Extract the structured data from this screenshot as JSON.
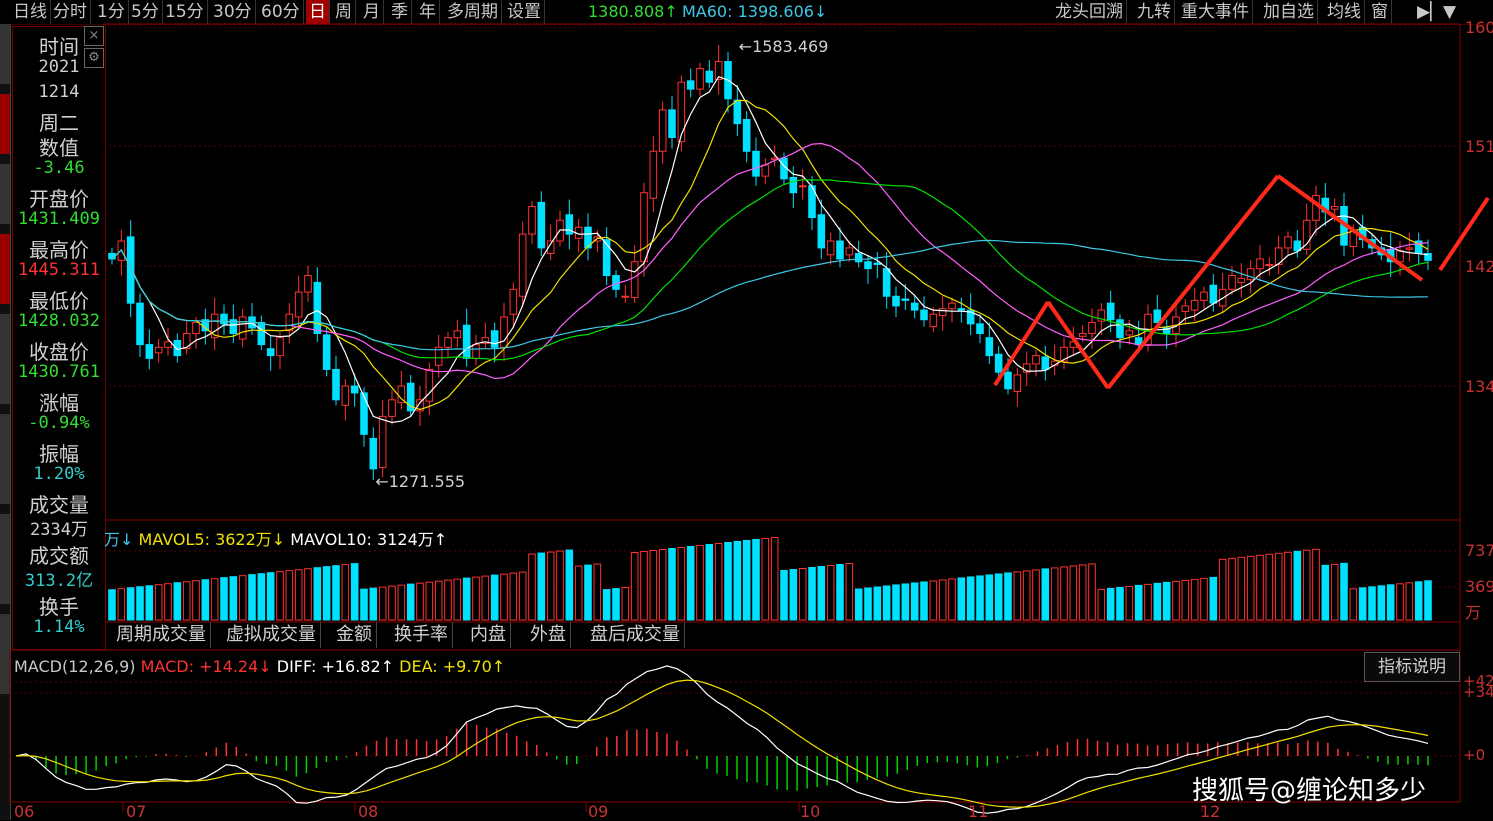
{
  "toolbar": {
    "items": [
      "日线",
      "分时",
      "1分",
      "5分",
      "15分",
      "30分",
      "60分",
      "日",
      "周",
      "月",
      "季",
      "年",
      "多周期",
      "设置"
    ],
    "ma30_value": "1380.808↑",
    "ma60_value": "MA60: 1398.606↓",
    "right_items": [
      "龙头回溯",
      "九转",
      "重大事件",
      "加自选",
      "均线",
      "窗"
    ]
  },
  "info_panel": {
    "rows": [
      {
        "label": "时间",
        "value": "2021",
        "value2": "1214",
        "value3": "周二",
        "color": "#d0d0d0"
      },
      {
        "label": "数值",
        "value": "-3.46",
        "color": "#33dd33"
      },
      {
        "label": "开盘价",
        "value": "1431.409",
        "color": "#33dd33"
      },
      {
        "label": "最高价",
        "value": "1445.311",
        "color": "#ff3333"
      },
      {
        "label": "最低价",
        "value": "1428.032",
        "color": "#33dd33"
      },
      {
        "label": "收盘价",
        "value": "1430.761",
        "color": "#33dd33"
      },
      {
        "label": "涨幅",
        "value": "-0.94%",
        "color": "#33dd33"
      },
      {
        "label": "振幅",
        "value": "1.20%",
        "color": "#33cccc"
      },
      {
        "label": "成交量",
        "value": "2334万",
        "color": "#d0d0d0"
      },
      {
        "label": "成交额",
        "value": "313.2亿",
        "color": "#33cccc"
      },
      {
        "label": "换手",
        "value": "1.14%",
        "color": "#33cccc"
      }
    ],
    "close_icon": "×",
    "gear_icon": "⚙"
  },
  "volume_legend": {
    "prefix": "万↓",
    "mavol5": "MAVOL5: 3622万↓",
    "mavol10": "MAVOL10: 3124万↑"
  },
  "volume_tabs": [
    "周期成交量",
    "虚拟成交量",
    "金额",
    "换手率",
    "内盘",
    "外盘",
    "盘后成交量"
  ],
  "macd_legend": {
    "name": "MACD(12,26,9)",
    "macd": "MACD: +14.24↓",
    "diff": "DIFF: +16.82↑",
    "dea": "DEA: +9.70↑"
  },
  "help_button": "指标说明",
  "watermark": "搜狐号@缠论知多少",
  "colors": {
    "up": "#ff3232",
    "down": "#00e0ff",
    "ma5": "#ffffff",
    "ma10": "#f0e000",
    "ma20": "#ff60ff",
    "ma30": "#00e000",
    "ma60": "#3cc8e6",
    "arrow": "#ff2a1a"
  },
  "chart_data": {
    "type": "candlestick",
    "months": [
      "06",
      "07",
      "08",
      "09",
      "10",
      "11",
      "12"
    ],
    "price_axis": [
      "160",
      "151",
      "142",
      "134"
    ],
    "volume_axis": [
      "737",
      "369",
      "万"
    ],
    "macd_axis": [
      "+42",
      "+34",
      "+0"
    ],
    "price_range": [
      1250,
      1610
    ],
    "max_label": "1583.469",
    "min_label": "1271.555",
    "closes": [
      1432,
      1445,
      1400,
      1370,
      1360,
      1368,
      1372,
      1362,
      1378,
      1386,
      1380,
      1392,
      1385,
      1378,
      1390,
      1382,
      1370,
      1362,
      1375,
      1392,
      1408,
      1420,
      1378,
      1352,
      1330,
      1340,
      1335,
      1305,
      1280,
      1318,
      1330,
      1340,
      1322,
      1330,
      1352,
      1368,
      1375,
      1380,
      1360,
      1370,
      1375,
      1368,
      1390,
      1410,
      1450,
      1470,
      1440,
      1445,
      1460,
      1450,
      1455,
      1440,
      1448,
      1420,
      1410,
      1405,
      1430,
      1480,
      1510,
      1540,
      1520,
      1560,
      1555,
      1570,
      1560,
      1575,
      1548,
      1530,
      1510,
      1492,
      1500,
      1505,
      1490,
      1480,
      1485,
      1462,
      1440,
      1445,
      1432,
      1440,
      1430,
      1425,
      1428,
      1405,
      1398,
      1402,
      1395,
      1388,
      1392,
      1396,
      1400,
      1395,
      1385,
      1378,
      1362,
      1350,
      1338,
      1348,
      1356,
      1362,
      1352,
      1358,
      1368,
      1372,
      1378,
      1386,
      1395,
      1388,
      1375,
      1380,
      1370,
      1392,
      1386,
      1378,
      1390,
      1398,
      1402,
      1408,
      1400,
      1410,
      1420,
      1418,
      1425,
      1432,
      1428,
      1440,
      1448,
      1438,
      1460,
      1478,
      1466,
      1470,
      1442,
      1452,
      1446,
      1440,
      1435,
      1430,
      1438,
      1440,
      1436,
      1431
    ],
    "mavol_values": [
      3622,
      3124
    ],
    "macd_values": {
      "macd": 14.24,
      "diff": 16.82,
      "dea": 9.7
    }
  }
}
